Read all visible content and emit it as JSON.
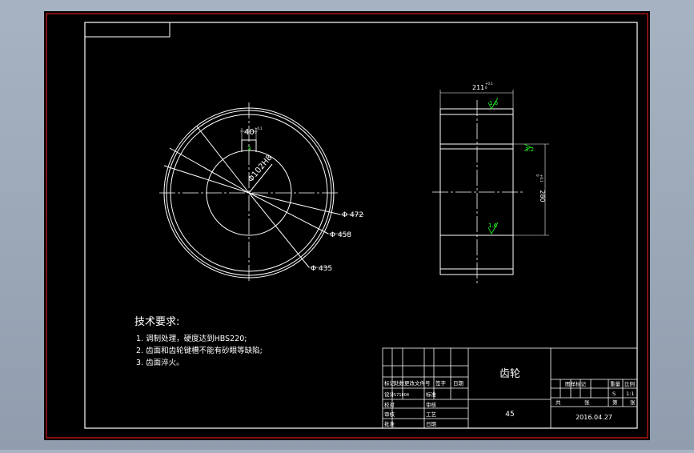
{
  "colors": {
    "background": "#000000",
    "outer_frame": "#ff2020",
    "lines": "#ffffff",
    "hatch": "#ff2020",
    "symbols": "#22ff22",
    "window": "#9aa6b6"
  },
  "front_view": {
    "key_width": "40",
    "key_tol": [
      "+0.1",
      "0"
    ],
    "keyway_symbol": "3",
    "bore": "Φ102H8",
    "dia_472": "Φ 472",
    "dia_458": "Φ 458",
    "dia_435": "Φ 435"
  },
  "side_view": {
    "width": "211",
    "width_tol": [
      "+0.1",
      "0"
    ],
    "height": "280",
    "height_tol": [
      "+0.1",
      "0"
    ],
    "rough_top": "1.6",
    "rough_side": "3.2",
    "rough_bottom": "1.6"
  },
  "requirements": {
    "title": "技术要求:",
    "items": [
      "1. 调制处理，硬度达到HBS220;",
      "2. 齿面和齿轮键槽不能有砂眼等缺陷;",
      "3. 齿面淬火。"
    ]
  },
  "title_block": {
    "part_name": "齿轮",
    "material": "45",
    "date": "2016.04.27",
    "labels": {
      "mark": "标记",
      "count": "处数",
      "change_doc": "更改文件号",
      "signature": "签字",
      "date": "日期",
      "design": "设计",
      "proofread": "校对",
      "review": "审核",
      "approve": "批准",
      "standardize": "标准",
      "audit": "审核",
      "craft": "工艺",
      "stage_mark": "图样标记",
      "weight": "重量",
      "scale": "比例",
      "sheet": "共",
      "sheet_of": "张",
      "page": "第",
      "page_of": "张",
      "scale_value": "1:1",
      "designer_id": "171804",
      "stage_s": "S"
    }
  }
}
